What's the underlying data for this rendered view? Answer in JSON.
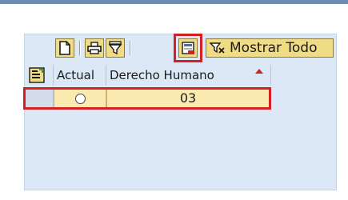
{
  "toolbar": {
    "new_icon": "new-document-icon",
    "print_icon": "print-icon",
    "filter_icon": "filter-icon",
    "export_icon": "export-icon",
    "show_all_icon": "show-all-icon",
    "show_all_label": "Mostrar Todo"
  },
  "table": {
    "columns": [
      "Actual",
      "Derecho Humano"
    ],
    "sorted_column": "Derecho Humano",
    "rows": [
      {
        "actual_selected": false,
        "derecho_humano": "03"
      }
    ]
  },
  "colors": {
    "highlight": "#d42020",
    "button_face": "#f1dc86",
    "panel_bg": "#dce8f5"
  }
}
